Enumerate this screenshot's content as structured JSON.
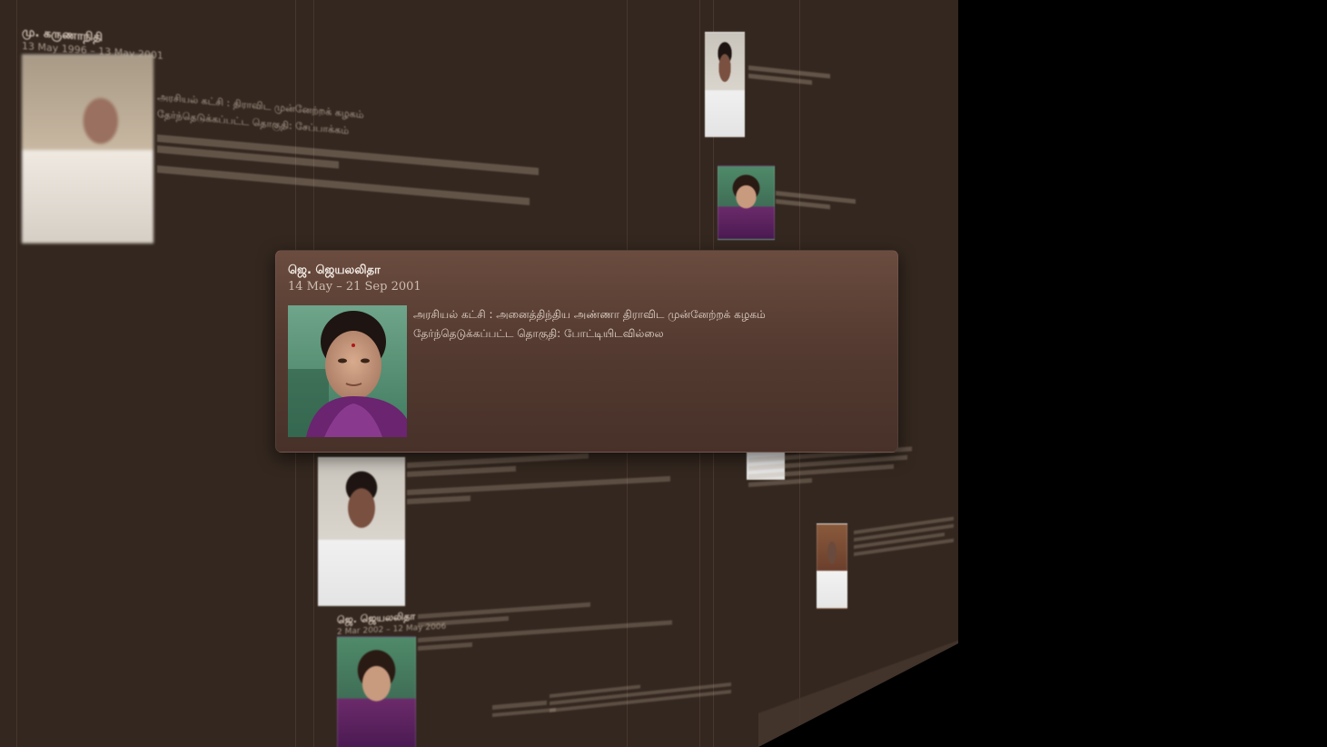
{
  "popup": {
    "name": "ஜெ. ஜெயலலிதா",
    "term": "14 May – 21 Sep 2001",
    "party_line": "அரசியல் கட்சி : அனைத்திந்திய அண்ணா திராவிட முன்னேற்றக் கழகம்",
    "constituency_line": "தேர்ந்தெடுக்கப்பட்ட தொகுதி: போட்டியிடவில்லை"
  },
  "background_cards": {
    "card1_name": "மு. கருணாநிதி",
    "card1_term": "13 May 1996 – 13 May 2001",
    "card1_line1": "அரசியல் கட்சி : திராவிட முன்னேற்றக் கழகம்",
    "card1_line2": "தேர்ந்தெடுக்கப்பட்ட தொகுதி: சேப்பாக்கம்",
    "card2_name": "ஜெ. ஜெயலலிதா",
    "card2_term": "2 Mar 2002 – 12 May 2006"
  },
  "colors": {
    "page_background": "#000000",
    "plane_background": "#33271f",
    "popup_top": "#6b4c3f",
    "popup_bottom": "#473129",
    "popup_text": "#f3ece6"
  }
}
